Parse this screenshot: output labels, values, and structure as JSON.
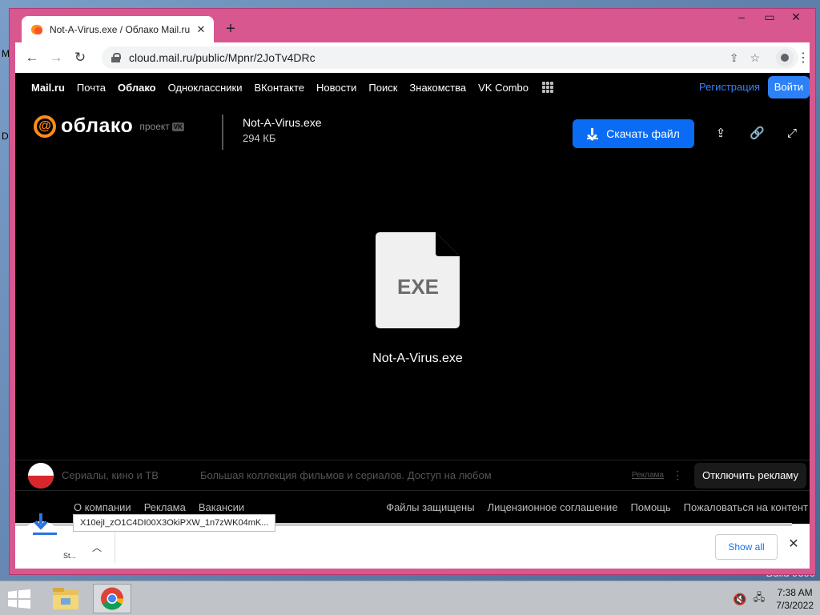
{
  "desktop": {
    "side_letters": [
      "M",
      "D"
    ],
    "build_text": "Build 9600",
    "partial_number": "0"
  },
  "browser": {
    "tab": {
      "title": "Not-A-Virus.exe / Облако Mail.ru"
    },
    "url": "cloud.mail.ru/public/Mpnr/2JoTv4DRc"
  },
  "portal_nav": {
    "items": [
      "Mail.ru",
      "Почта",
      "Облако",
      "Одноклассники",
      "ВКонтакте",
      "Новости",
      "Поиск",
      "Знакомства",
      "VK Combo"
    ],
    "register": "Регистрация",
    "login": "Войти"
  },
  "cloud": {
    "logo_text": "облако",
    "project_label": "проект",
    "vk_badge": "VK",
    "file_name": "Not-A-Virus.exe",
    "file_size": "294 КБ",
    "download_label": "Скачать файл",
    "file_ext": "EXE",
    "file_caption": "Not-A-Virus.exe"
  },
  "ad": {
    "title": "Сериалы, кино и ТВ",
    "text": "Большая коллекция фильмов и сериалов. Доступ на любом",
    "label": "Реклама",
    "disable": "Отключить рекламу"
  },
  "footer": {
    "left": [
      "О компании",
      "Реклама",
      "Вакансии"
    ],
    "right": [
      "Файлы защищены",
      "Лицензионное соглашение",
      "Помощь",
      "Пожаловаться на контент"
    ]
  },
  "downloads": {
    "tooltip": "X10ejI_zO1C4DI00X3OkiPXW_1n7zWK04mK...",
    "item_name": "St...",
    "show_all": "Show all"
  },
  "taskbar": {
    "time": "7:38 AM",
    "date": "7/3/2022"
  }
}
